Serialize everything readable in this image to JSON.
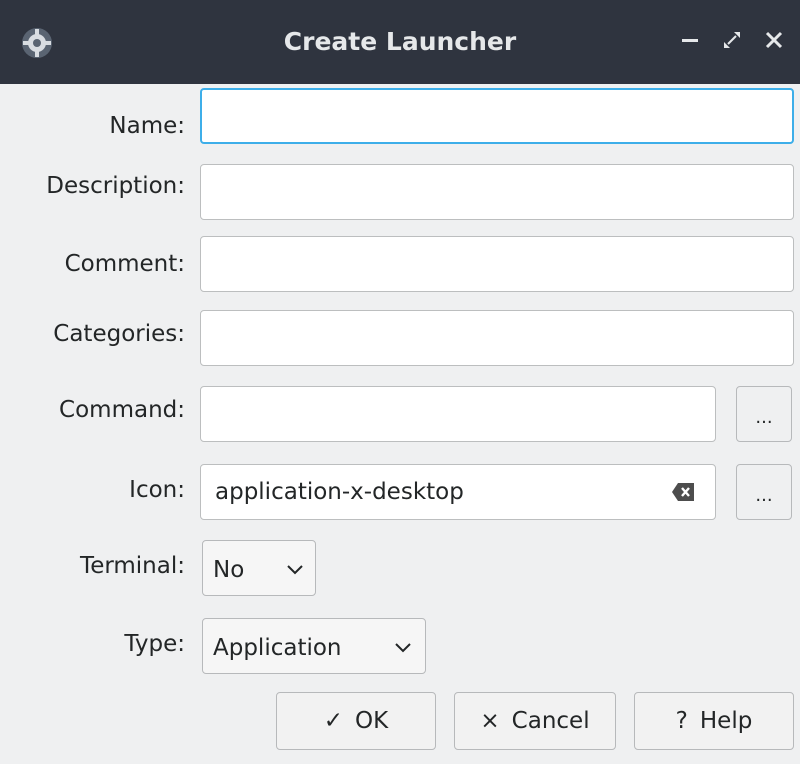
{
  "window": {
    "title": "Create Launcher",
    "minimize_glyph": "–",
    "close_glyph": "✕"
  },
  "form": {
    "name_label": "Name:",
    "name_value": "",
    "description_label": "Description:",
    "description_value": "",
    "comment_label": "Comment:",
    "comment_value": "",
    "categories_label": "Categories:",
    "categories_value": "",
    "command_label": "Command:",
    "command_value": "",
    "command_browse": "...",
    "icon_label": "Icon:",
    "icon_value": "application-x-desktop",
    "icon_browse": "...",
    "terminal_label": "Terminal:",
    "terminal_value": "No",
    "type_label": "Type:",
    "type_value": "Application"
  },
  "buttons": {
    "ok_label": "OK",
    "ok_icon": "✓",
    "cancel_label": "Cancel",
    "cancel_icon": "×",
    "help_label": "Help",
    "help_icon": "?"
  },
  "icons": {
    "app": "gear-icon",
    "minimize": "minimize-icon",
    "restore": "restore-icon",
    "close": "close-icon",
    "clear": "clear-text-icon",
    "dropdown": "chevron-down-icon"
  },
  "colors": {
    "titlebar": "#2f343f",
    "window_bg": "#eff0f1",
    "focus": "#3daee9",
    "text": "#232627"
  }
}
